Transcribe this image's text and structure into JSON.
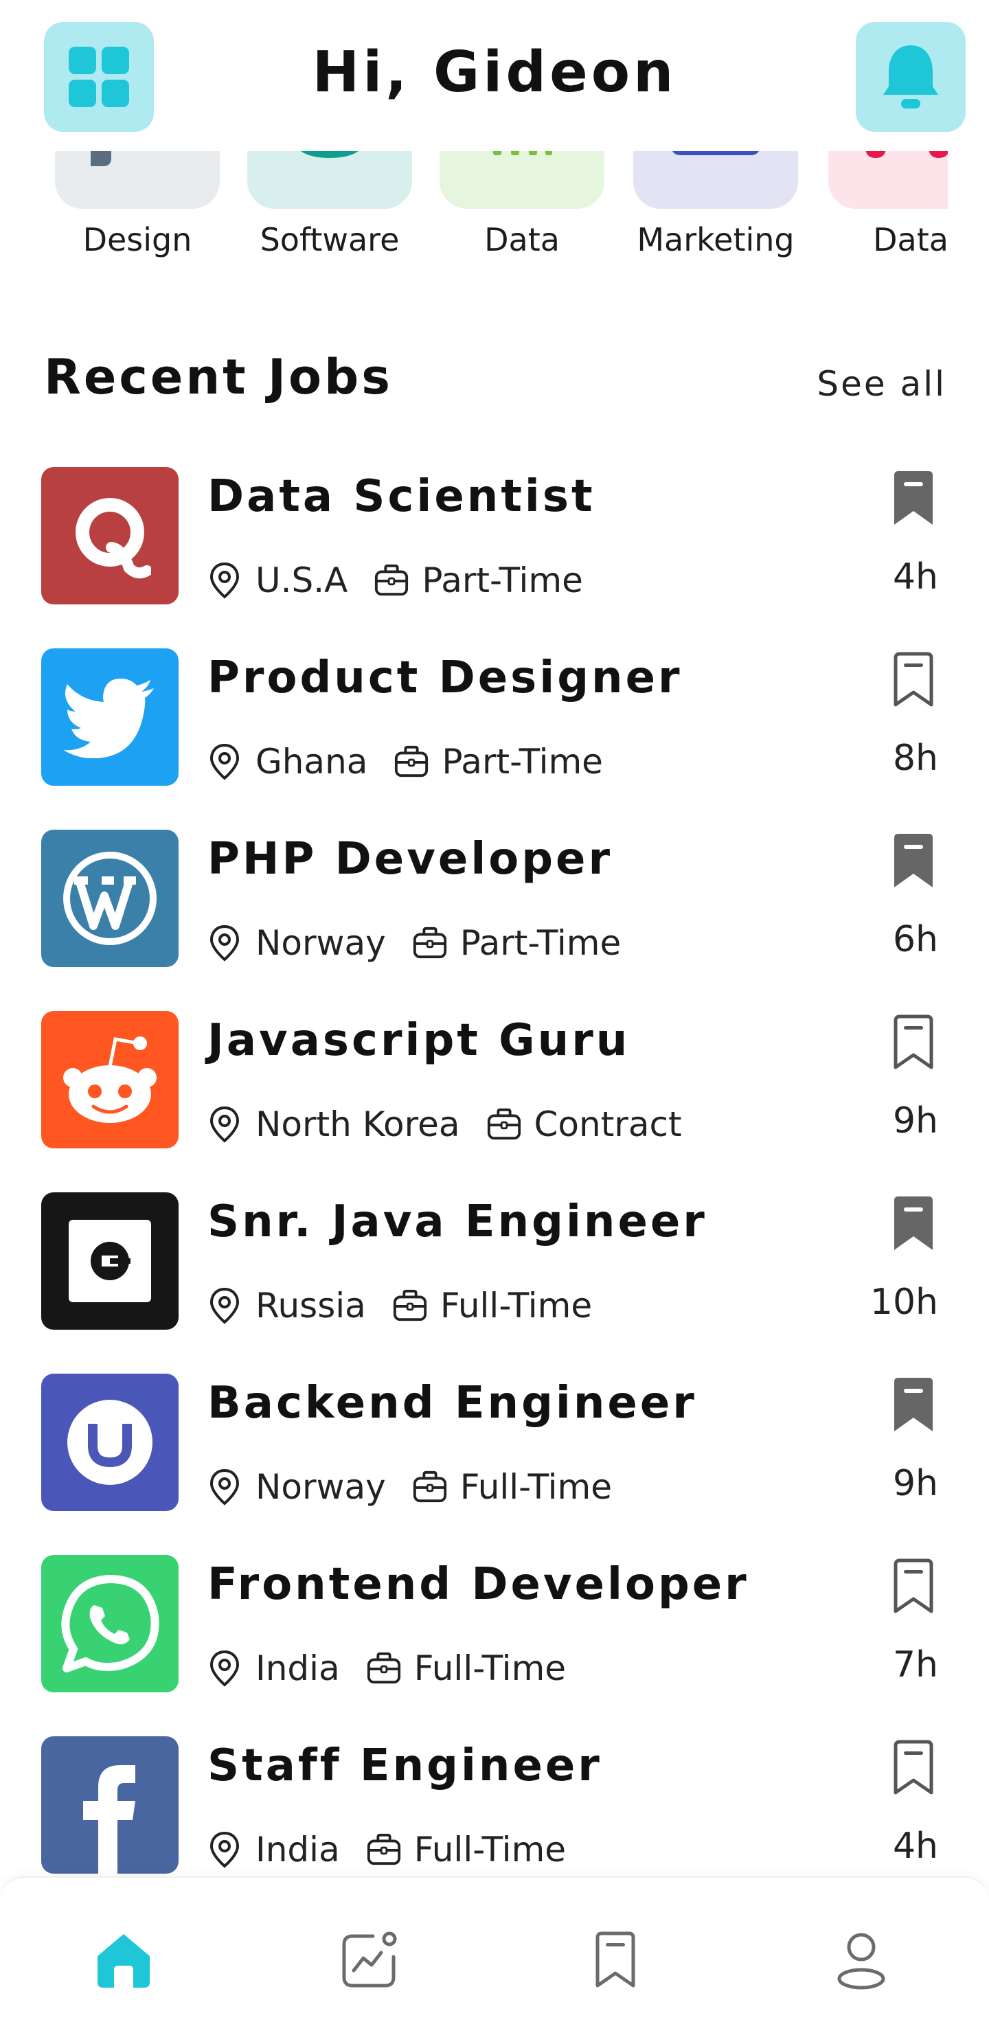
{
  "header": {
    "greeting": "Hi, Gideon"
  },
  "categories": [
    {
      "label": "Design"
    },
    {
      "label": "Software"
    },
    {
      "label": "Data"
    },
    {
      "label": "Marketing"
    },
    {
      "label": "Data"
    }
  ],
  "recent": {
    "title": "Recent Jobs",
    "see_all": "See all"
  },
  "jobs": [
    {
      "title": "Data Scientist",
      "location": "U.S.A",
      "type": "Part-Time",
      "time": "4h",
      "company_icon": "quora-icon",
      "logo_color": "#b94040",
      "bookmarked": true
    },
    {
      "title": "Product Designer",
      "location": "Ghana",
      "type": "Part-Time",
      "time": "8h",
      "company_icon": "twitter-icon",
      "logo_color": "#1da1f2",
      "bookmarked": false
    },
    {
      "title": "PHP Developer",
      "location": "Norway",
      "type": "Part-Time",
      "time": "6h",
      "company_icon": "wordpress-icon",
      "logo_color": "#3a80a8",
      "bookmarked": true
    },
    {
      "title": "Javascript Guru",
      "location": "North Korea",
      "type": "Contract",
      "time": "9h",
      "company_icon": "reddit-icon",
      "logo_color": "#ff5622",
      "bookmarked": false
    },
    {
      "title": "Snr. Java Engineer",
      "location": "Russia",
      "type": "Full-Time",
      "time": "10h",
      "company_icon": "uber-icon",
      "logo_color": "#161616",
      "bookmarked": true
    },
    {
      "title": "Backend Engineer",
      "location": "Norway",
      "type": "Full-Time",
      "time": "9h",
      "company_icon": "upwork-icon",
      "logo_color": "#4a56b8",
      "bookmarked": true
    },
    {
      "title": "Frontend Developer",
      "location": "India",
      "type": "Full-Time",
      "time": "7h",
      "company_icon": "whatsapp-icon",
      "logo_color": "#39d272",
      "bookmarked": false
    },
    {
      "title": "Staff Engineer",
      "location": "India",
      "type": "Full-Time",
      "time": "4h",
      "company_icon": "facebook-icon",
      "logo_color": "#4a66a0",
      "bookmarked": false
    }
  ],
  "bottom_nav": [
    {
      "icon": "home-icon",
      "active": true
    },
    {
      "icon": "activity-chart-icon",
      "active": false
    },
    {
      "icon": "bookmark-icon",
      "active": false
    },
    {
      "icon": "profile-icon",
      "active": false
    }
  ],
  "colors": {
    "accent": "#1ec6d8",
    "accent_light": "#aeeaef",
    "icon_gray": "#6b6b6b"
  }
}
